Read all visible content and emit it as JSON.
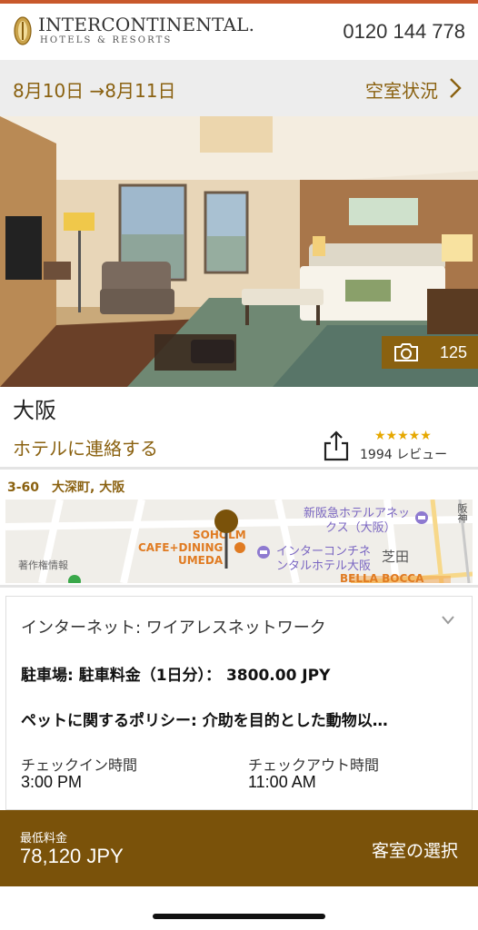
{
  "header": {
    "brand_main": "INTERCONTINENTAL.",
    "brand_sub": "HOTELS & RESORTS",
    "phone": "0120 144 778"
  },
  "datebar": {
    "dates": "8月10日 →8月11日",
    "availability": "空室状況"
  },
  "hero": {
    "photo_count": "125"
  },
  "hotel": {
    "city": "大阪",
    "contact": "ホテルに連絡する",
    "stars": "★★★★★",
    "reviews": "1994 レビュー"
  },
  "location": {
    "address": "3-60　大深町, 大阪",
    "map_labels": {
      "soholm": "SOHOLM",
      "cafe": "CAFE+DINING",
      "umeda": "UMEDA",
      "hankyu_1": "新阪急ホテルアネッ",
      "hankyu_2": "クス（大阪）",
      "ic_1": "インターコンチネ",
      "ic_2": "ンタルホテル大阪",
      "shibata": "芝田",
      "bella": "BELLA BOCCA",
      "kobe": "阪神",
      "credit": "著作権情報"
    }
  },
  "details": {
    "internet": "インターネット: ワイアレスネットワーク",
    "parking": "駐車場: 駐車料金（1日分）： 3800.00 JPY",
    "pet": "ペットに関するポリシー: 介助を目的とした動物以…",
    "checkin_label": "チェックイン時間",
    "checkin_value": "3:00 PM",
    "checkout_label": "チェックアウト時間",
    "checkout_value": "11:00 AM"
  },
  "pricebar": {
    "label": "最低料金",
    "price": "78,120 JPY",
    "select": "客室の選択"
  },
  "colors": {
    "brand_gold": "#8a6110",
    "price_bar": "#7a520a",
    "accent_top": "#c8582b",
    "star": "#e6a800"
  }
}
